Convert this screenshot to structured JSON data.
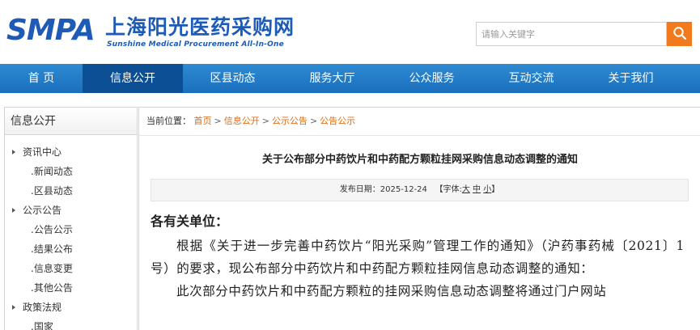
{
  "header": {
    "logo_abbr": "SMPA",
    "logo_cn": "上海阳光医药采购网",
    "logo_en": "Sunshine Medical Procurement All-In-One",
    "search_placeholder": "请输入关键字",
    "search_icon": "search-icon",
    "accent_color": "#f07a1d",
    "brand_color": "#1e5bb6"
  },
  "nav": {
    "items": [
      {
        "label": "首 页"
      },
      {
        "label": "信息公开"
      },
      {
        "label": "区县动态"
      },
      {
        "label": "服务大厅"
      },
      {
        "label": "公众服务"
      },
      {
        "label": "互动交流"
      },
      {
        "label": "关于我们"
      }
    ],
    "active_index": 1
  },
  "sidebar": {
    "title": "信息公开",
    "items": [
      {
        "label": "资讯中心",
        "level": 1
      },
      {
        "label": ".新闻动态",
        "level": 2
      },
      {
        "label": ".区县动态",
        "level": 2
      },
      {
        "label": "公示公告",
        "level": 1
      },
      {
        "label": ".公告公示",
        "level": 2
      },
      {
        "label": ".结果公布",
        "level": 2
      },
      {
        "label": ".信息变更",
        "level": 2
      },
      {
        "label": ".其他公告",
        "level": 2
      },
      {
        "label": "政策法规",
        "level": 1
      },
      {
        "label": ".国家",
        "level": 2
      }
    ]
  },
  "breadcrumb": {
    "prefix": "当前位置：",
    "items": [
      "首页",
      "信息公开",
      "公示公告",
      "公告公示"
    ],
    "separator": ">"
  },
  "article": {
    "title": "关于公布部分中药饮片和中药配方颗粒挂网采购信息动态调整的通知",
    "meta": {
      "date_label": "发布日期：",
      "date": "2025-12-24",
      "font_label_open": "【字体:",
      "font_large": "大",
      "font_medium": "中",
      "font_small": "小",
      "font_label_close": "】"
    },
    "salutation": "各有关单位：",
    "paragraphs": [
      "根据《关于进一步完善中药饮片“阳光采购”管理工作的通知》（沪药事药械〔2021〕1号）的要求，现公布部分中药饮片和中药配方颗粒挂网信息动态调整的通知：",
      "此次部分中药饮片和中药配方颗粒的挂网采购信息动态调整将通过门户网站"
    ]
  }
}
